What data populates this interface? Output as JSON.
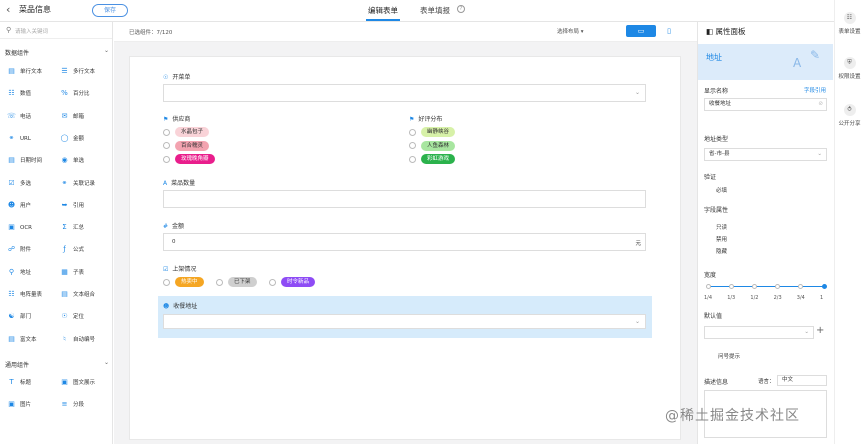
{
  "header": {
    "back_icon": "chevron-left-icon",
    "title": "菜品信息",
    "save_label": "保存",
    "tabs": [
      {
        "label": "编辑表单",
        "active": true
      },
      {
        "label": "表单填报"
      }
    ],
    "help_icon": "question-circle-icon"
  },
  "left_panel": {
    "search_placeholder": "请输入关键词",
    "sections": [
      {
        "title": "数据组件",
        "items": [
          {
            "label": "单行文本",
            "icon": "single-text-icon"
          },
          {
            "label": "多行文本",
            "icon": "multi-text-icon"
          },
          {
            "label": "数值",
            "icon": "number-icon"
          },
          {
            "label": "百分比",
            "icon": "percent-icon"
          },
          {
            "label": "电话",
            "icon": "phone-icon"
          },
          {
            "label": "邮箱",
            "icon": "email-icon"
          },
          {
            "label": "URL",
            "icon": "url-icon"
          },
          {
            "label": "金额",
            "icon": "money-icon"
          },
          {
            "label": "日期时间",
            "icon": "calendar-icon"
          },
          {
            "label": "单选",
            "icon": "radio-icon"
          },
          {
            "label": "多选",
            "icon": "checkbox-icon"
          },
          {
            "label": "关联记录",
            "icon": "link-record-icon"
          },
          {
            "label": "用户",
            "icon": "user-icon"
          },
          {
            "label": "引用",
            "icon": "reference-icon"
          },
          {
            "label": "OCR",
            "icon": "ocr-icon"
          },
          {
            "label": "汇总",
            "icon": "sum-icon"
          },
          {
            "label": "附件",
            "icon": "attachment-icon"
          },
          {
            "label": "公式",
            "icon": "formula-icon"
          },
          {
            "label": "地址",
            "icon": "location-icon"
          },
          {
            "label": "子表",
            "icon": "subtable-icon"
          },
          {
            "label": "电阵量表",
            "icon": "matrix-icon"
          },
          {
            "label": "文本组合",
            "icon": "text-combine-icon"
          },
          {
            "label": "部门",
            "icon": "department-icon"
          },
          {
            "label": "定位",
            "icon": "position-icon"
          },
          {
            "label": "富文本",
            "icon": "rich-text-icon"
          },
          {
            "label": "自动编号",
            "icon": "auto-number-icon"
          }
        ]
      },
      {
        "title": "通用组件",
        "items": [
          {
            "label": "标题",
            "icon": "heading-icon"
          },
          {
            "label": "图文展示",
            "icon": "image-text-icon"
          },
          {
            "label": "图片",
            "icon": "image-icon"
          },
          {
            "label": "分段",
            "icon": "section-icon"
          }
        ]
      }
    ]
  },
  "toolbar": {
    "selected_count": "已选组件：7/120",
    "layout_label": "选择布局",
    "desktop_icon": "desktop-icon",
    "mobile_icon": "mobile-icon"
  },
  "form": {
    "fields": [
      {
        "label": "开菜单",
        "icon": "radio-circle-icon",
        "type": "select"
      },
      {
        "label": "供应商",
        "icon": "flag-icon",
        "options": [
          {
            "text": "水晶包子",
            "bg": "#f9d3d8",
            "color": "#333"
          },
          {
            "text": "百合糯灵",
            "bg": "#f3a3b0",
            "color": "#333"
          },
          {
            "text": "玫瑰晚角瓣",
            "bg": "#e91e8c",
            "color": "#fff"
          }
        ]
      },
      {
        "label": "好评分布",
        "icon": "flag-icon",
        "options": [
          {
            "text": "幽静峡谷",
            "bg": "#d7f1a8",
            "color": "#333"
          },
          {
            "text": "人鱼森林",
            "bg": "#a8e6a0",
            "color": "#333"
          },
          {
            "text": "彩虹游戏",
            "bg": "#2bb24c",
            "color": "#fff"
          }
        ]
      },
      {
        "label": "菜品数量",
        "icon": "text-a-icon",
        "type": "text"
      },
      {
        "label": "金额",
        "icon": "hash-icon",
        "value": "0",
        "unit": "元"
      },
      {
        "label": "上架情况",
        "icon": "checklist-icon",
        "options": [
          {
            "text": "热卖中",
            "bg": "#f5a623",
            "color": "#fff"
          },
          {
            "text": "已下架",
            "bg": "#cfcfcf",
            "color": "#333"
          },
          {
            "text": "时令新品",
            "bg": "#8e4cf5",
            "color": "#fff"
          }
        ]
      },
      {
        "label": "收餐地址",
        "icon": "user-location-icon",
        "type": "select"
      }
    ]
  },
  "props": {
    "header": "属性面板",
    "collapse_icon": "collapse-icon",
    "banner_title": "地址",
    "display_name_label": "显示名称",
    "field_ref": "字段引用",
    "display_name_value": "收餐地址",
    "address_type_label": "地址类型",
    "address_type_value": "省-市-县",
    "validation_label": "验证",
    "required": "必填",
    "field_props_label": "字段属性",
    "readonly": "只读",
    "disabled": "禁用",
    "hidden": "隐藏",
    "width_label": "宽度",
    "width_marks": [
      "1/4",
      "1/3",
      "1/2",
      "2/3",
      "3/4",
      "1"
    ],
    "width_value": 1,
    "default_label": "默认值",
    "q_hint": "问号提示",
    "desc_label": "描述信息",
    "lang_label": "语言：",
    "lang_value": "中文"
  },
  "far_right": [
    {
      "label": "表单设置",
      "icon": "form-settings-icon"
    },
    {
      "label": "权限设置",
      "icon": "shield-icon"
    },
    {
      "label": "公开分享",
      "icon": "share-icon"
    }
  ],
  "watermark": "@稀土掘金技术社区"
}
